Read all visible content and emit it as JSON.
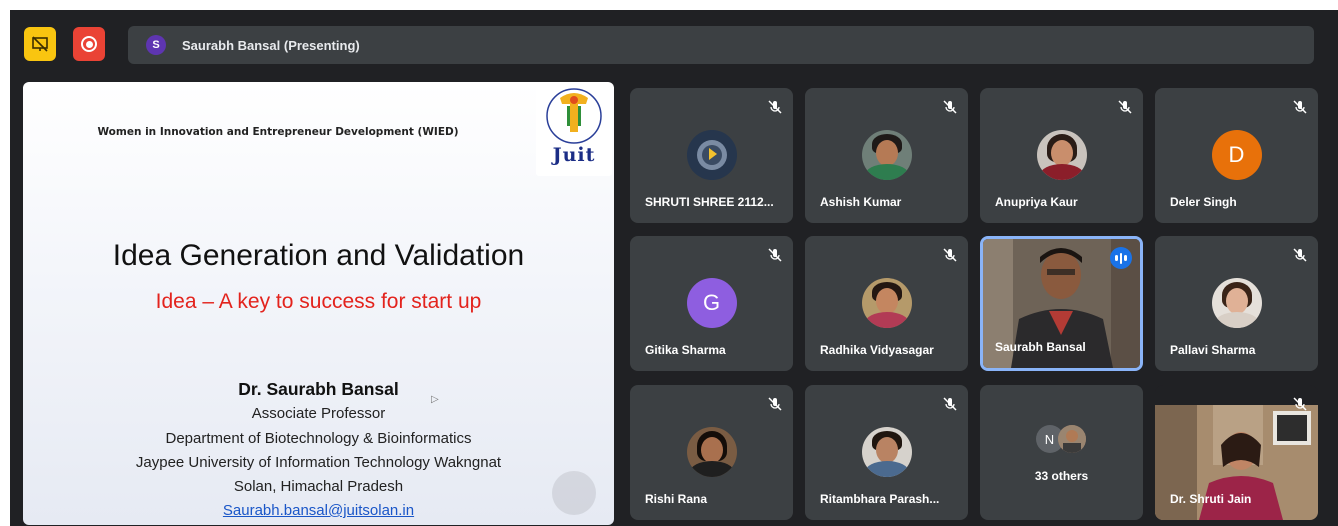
{
  "meeting": {
    "presenter_initial": "S",
    "presenter_banner": "Saurabh Bansal (Presenting)",
    "buttons": {
      "yellow_icon": "presentation-off-icon",
      "red_icon": "record-icon"
    }
  },
  "slide": {
    "header": "Women in Innovation and Entrepreneur Development (WIED)",
    "logo_text": "Juit",
    "title": "Idea Generation and Validation",
    "subtitle": "Idea – A key to success for start up",
    "author": "Dr. Saurabh Bansal",
    "role": "Associate Professor",
    "department": "Department of Biotechnology & Bioinformatics",
    "university": "Jaypee University of Information Technology Wakngnat",
    "location": "Solan, Himachal Pradesh",
    "email": "Saurabh.bansal@juitsolan.in"
  },
  "participants": [
    {
      "name": "SHRUTI SHREE 2112...",
      "kind": "image-avatar",
      "muted": true
    },
    {
      "name": "Ashish Kumar",
      "kind": "photo",
      "muted": true
    },
    {
      "name": "Anupriya Kaur",
      "kind": "photo",
      "muted": true
    },
    {
      "name": "Deler Singh",
      "kind": "letter",
      "letter": "D",
      "color": "#e8710a",
      "muted": true
    },
    {
      "name": "Gitika Sharma",
      "kind": "letter",
      "letter": "G",
      "color": "#8e5ee0",
      "muted": true
    },
    {
      "name": "Radhika Vidyasagar",
      "kind": "photo",
      "muted": true
    },
    {
      "name": "Saurabh Bansal",
      "kind": "video",
      "speaking": true
    },
    {
      "name": "Pallavi Sharma",
      "kind": "photo",
      "muted": true
    },
    {
      "name": "Rishi Rana",
      "kind": "photo",
      "muted": true
    },
    {
      "name": "Ritambhara Parash...",
      "kind": "photo",
      "muted": true
    },
    {
      "name": "33 others",
      "kind": "others",
      "letter": "N"
    },
    {
      "name": "Dr. Shruti Jain",
      "kind": "video",
      "muted": true
    }
  ],
  "colors": {
    "background": "#202124",
    "tile": "#3c4043",
    "speaking_border": "#8ab4f8",
    "record_red": "#ea4335",
    "present_yellow": "#f9c510"
  }
}
